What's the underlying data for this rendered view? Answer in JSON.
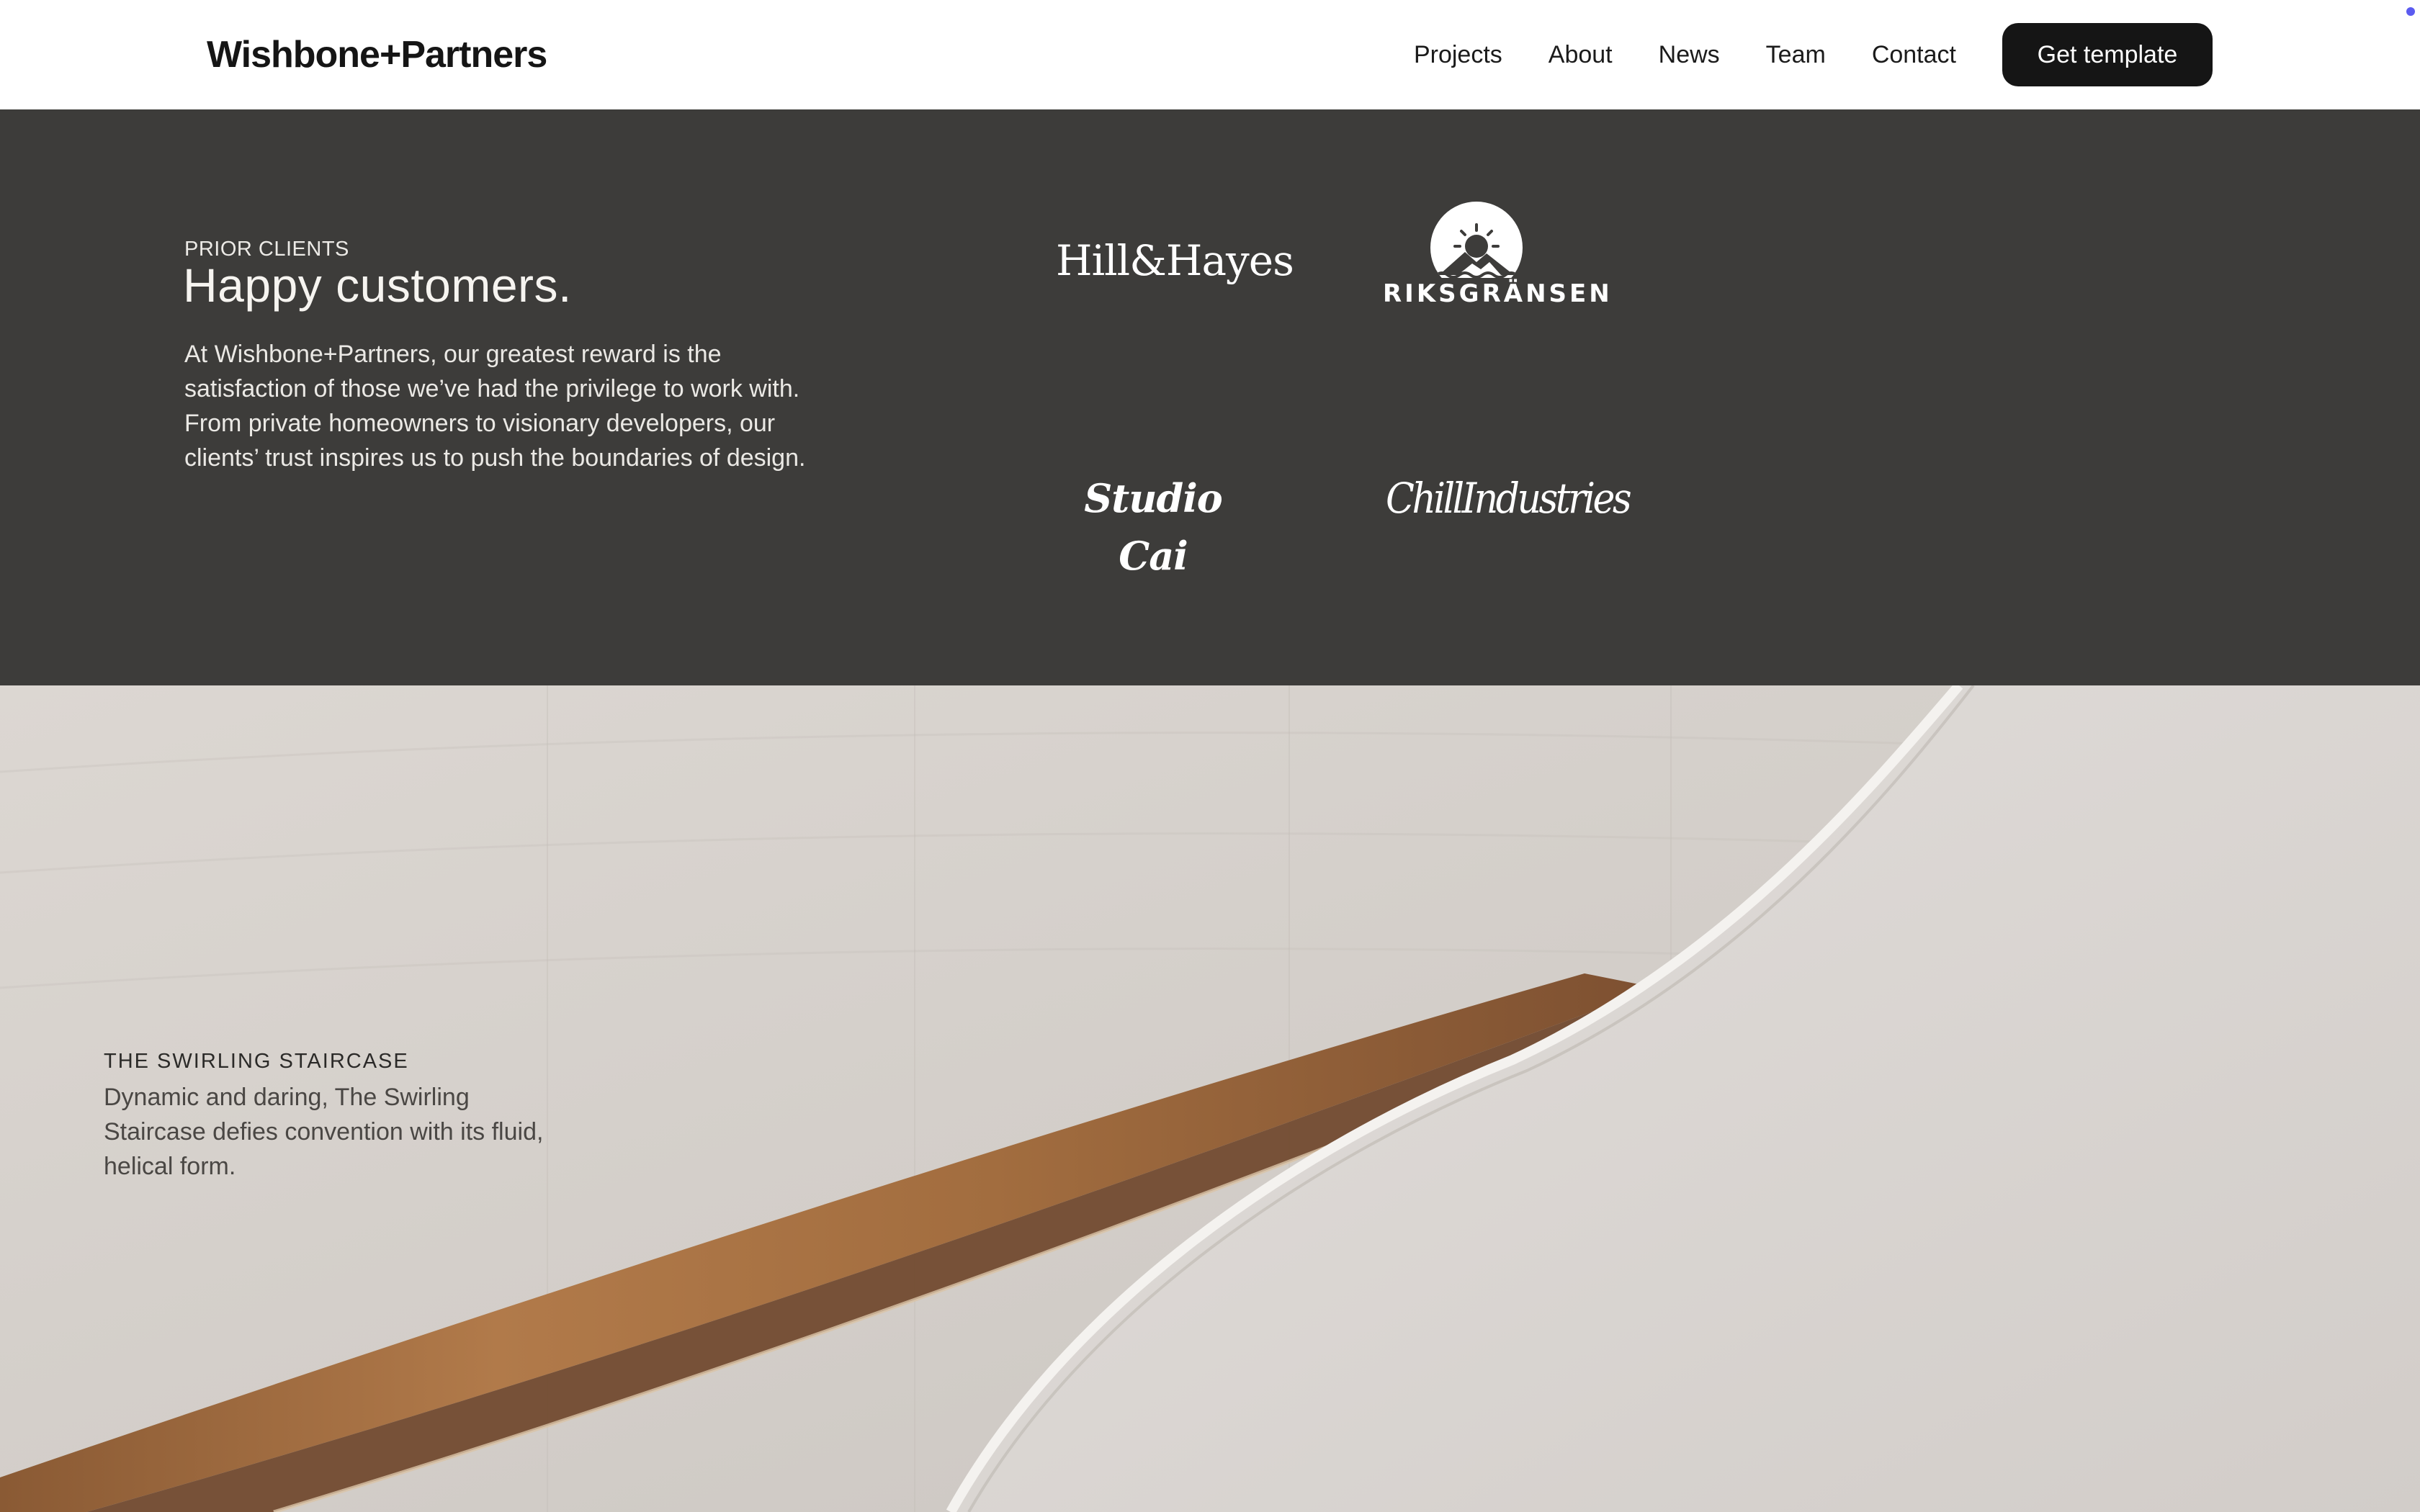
{
  "header": {
    "brand": "Wishbone+Partners",
    "nav": [
      "Projects",
      "About",
      "News",
      "Team",
      "Contact"
    ],
    "cta_label": "Get template"
  },
  "clients": {
    "eyebrow": "PRIOR CLIENTS",
    "title": "Happy customers.",
    "body": "At Wishbone+Partners, our greatest reward is the satisfaction of those we’ve had the privilege to work with. From private homeowners to visionary developers, our clients’ trust inspires us to push the boundaries of design.",
    "logos": {
      "hill_hayes": "Hill&Hayes",
      "riksgransen": "RIKSGRÄNSEN",
      "studio_cai": "Studio Cai",
      "chill_industries": "ChillIndustries"
    }
  },
  "hero": {
    "eyebrow": "THE SWIRLING STAIRCASE",
    "body": "Dynamic and daring, The Swirling Staircase defies convention with its fluid, helical form."
  },
  "colors": {
    "header_bg": "#ffffff",
    "clients_bg": "#3d3c3a",
    "cta_bg": "#151515",
    "accent_dot": "#5b5bf0"
  }
}
